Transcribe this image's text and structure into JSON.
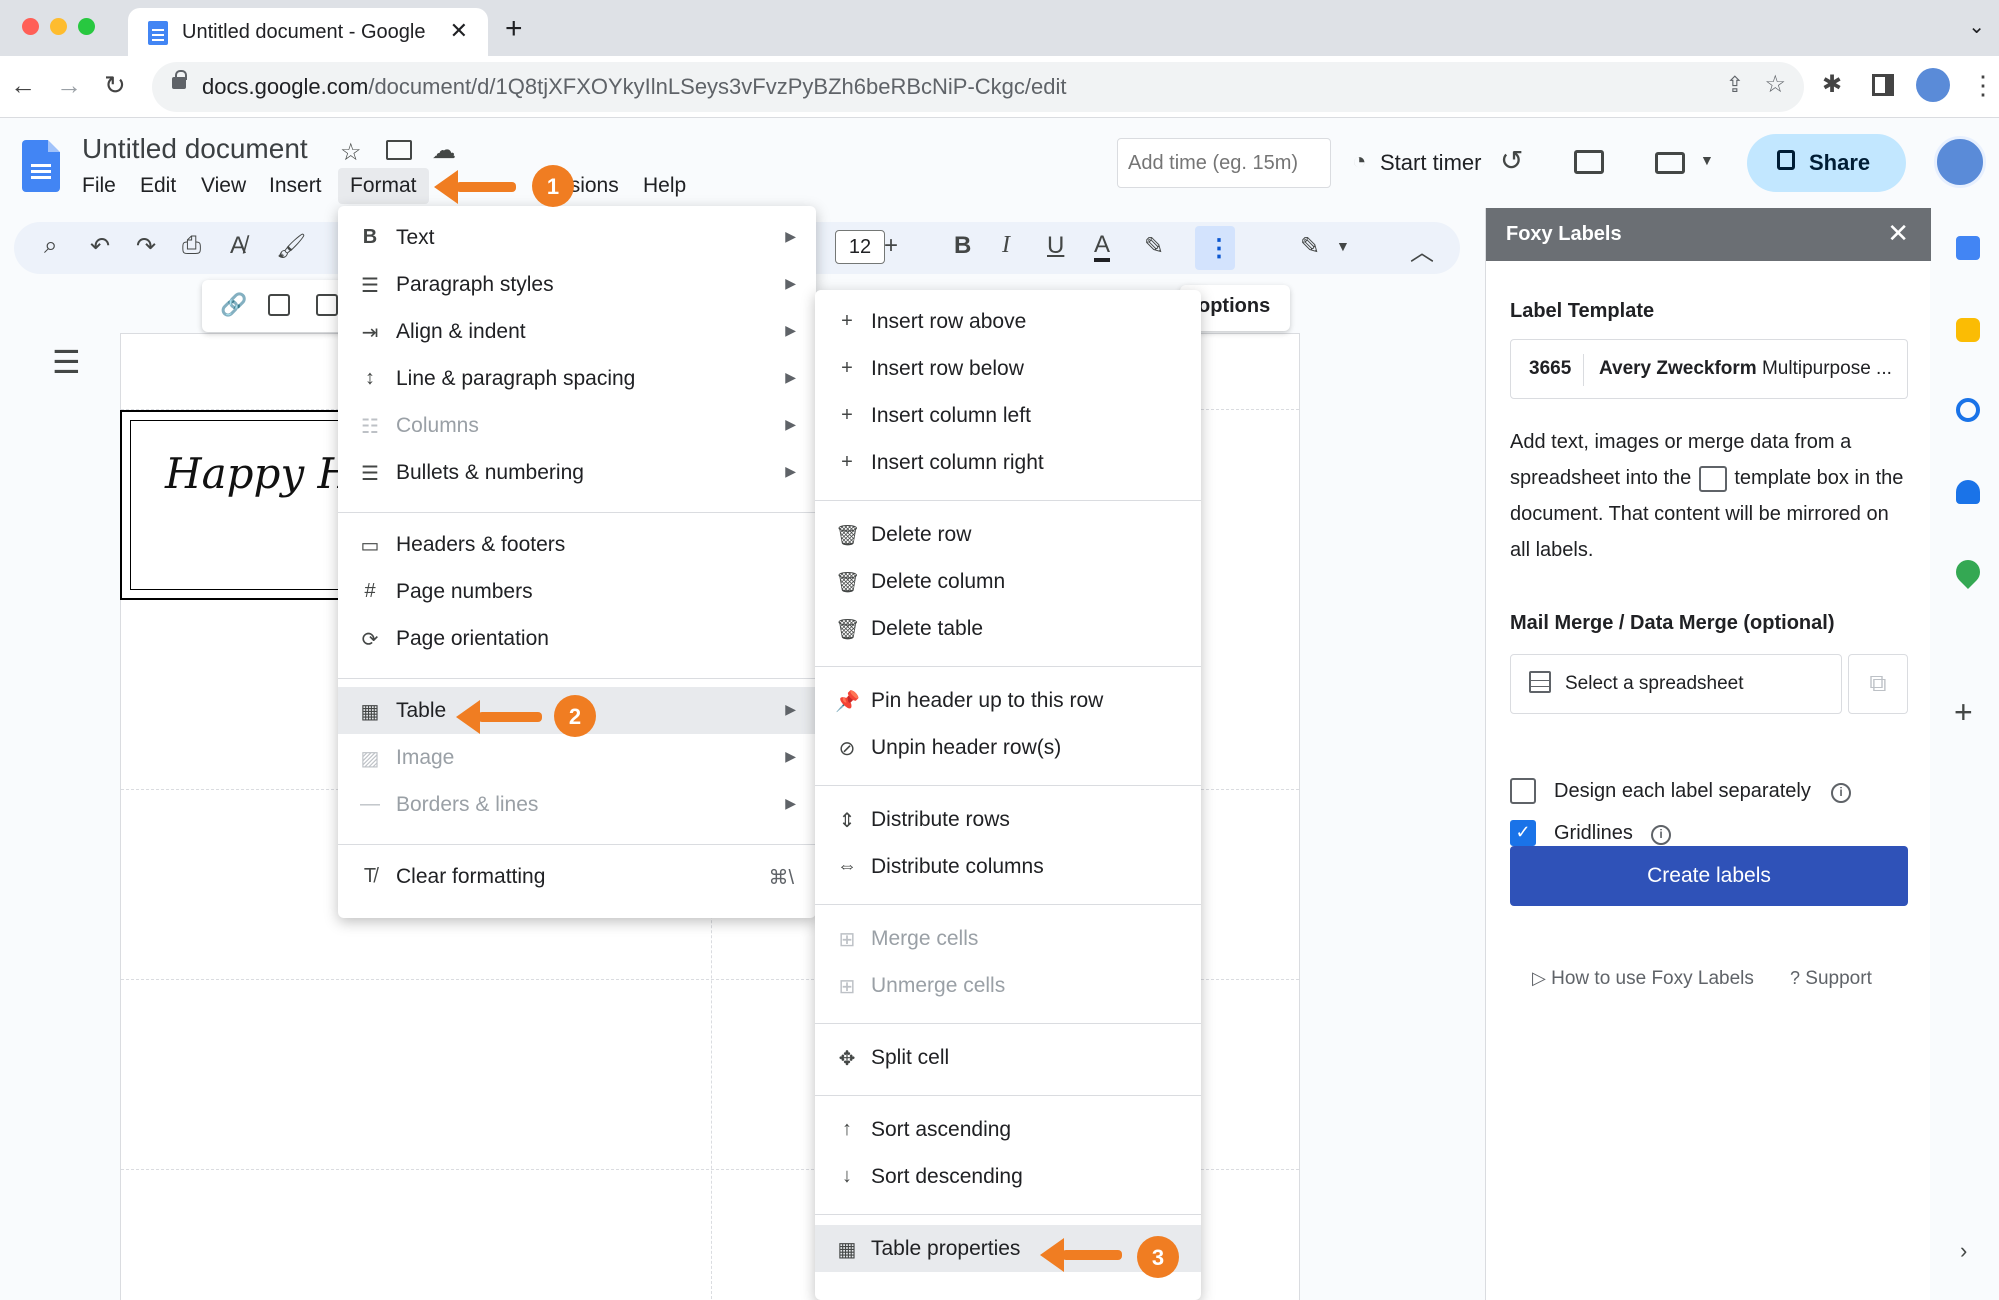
{
  "browser": {
    "tab_title": "Untitled document - Google Docs",
    "url_host": "docs.google.com",
    "url_path": "/document/d/1Q8tjXFXOYkyIlnLSeys3vFvzPyBZh6beRBcNiP-Ckgc/edit"
  },
  "docs": {
    "title": "Untitled document",
    "menus": [
      "File",
      "Edit",
      "View",
      "Insert",
      "Format",
      "Extensions",
      "Help"
    ],
    "time_placeholder": "Add time (eg. 15m)",
    "start_timer": "Start timer",
    "share": "Share",
    "font_size": "12",
    "options_tooltip": "options",
    "label_text": "Happy Holidays"
  },
  "format_menu": {
    "items": [
      {
        "icon": "bold-b-icon",
        "label": "Text"
      },
      {
        "icon": "paragraph-styles-icon",
        "label": "Paragraph styles"
      },
      {
        "icon": "indent-icon",
        "label": "Align & indent"
      },
      {
        "icon": "line-spacing-icon",
        "label": "Line & paragraph spacing"
      },
      {
        "icon": "columns-icon",
        "label": "Columns"
      },
      {
        "icon": "bullets-icon",
        "label": "Bullets & numbering"
      },
      {
        "icon": "headers-footers-icon",
        "label": "Headers & footers"
      },
      {
        "icon": "hash-icon",
        "label": "Page numbers"
      },
      {
        "icon": "page-orientation-icon",
        "label": "Page orientation"
      },
      {
        "icon": "table-icon",
        "label": "Table"
      },
      {
        "icon": "image-icon",
        "label": "Image"
      },
      {
        "icon": "borders-icon",
        "label": "Borders & lines"
      },
      {
        "icon": "clear-formatting-icon",
        "label": "Clear formatting",
        "shortcut": "⌘\\"
      }
    ]
  },
  "table_menu": {
    "items": [
      {
        "label": "Insert row above"
      },
      {
        "label": "Insert row below"
      },
      {
        "label": "Insert column left"
      },
      {
        "label": "Insert column right"
      },
      {
        "label": "Delete row"
      },
      {
        "label": "Delete column"
      },
      {
        "label": "Delete table"
      },
      {
        "label": "Pin header up to this row"
      },
      {
        "label": "Unpin header row(s)"
      },
      {
        "label": "Distribute rows"
      },
      {
        "label": "Distribute columns"
      },
      {
        "label": "Merge cells"
      },
      {
        "label": "Unmerge cells"
      },
      {
        "label": "Split cell"
      },
      {
        "label": "Sort ascending"
      },
      {
        "label": "Sort descending"
      },
      {
        "label": "Table properties"
      }
    ]
  },
  "annotations": {
    "step1": "1",
    "step2": "2",
    "step3": "3",
    "color": "#f07d22"
  },
  "panel": {
    "title": "Foxy Labels",
    "label_template_heading": "Label Template",
    "template_code": "3665",
    "template_brand": "Avery Zweckform",
    "template_name": " Multipurpose ...",
    "desc_part1": "Add text, images or merge data from a spreadsheet into the",
    "desc_part2": "template box in the document. That content will be mirrored on all labels.",
    "mail_merge_heading": "Mail Merge / Data Merge (optional)",
    "select_spreadsheet": "Select a spreadsheet",
    "design_each": "Design each label separately",
    "gridlines": "Gridlines",
    "create_labels": "Create labels",
    "how_to": "How to use Foxy Labels",
    "support": "Support",
    "accent": "#2f52b8"
  }
}
